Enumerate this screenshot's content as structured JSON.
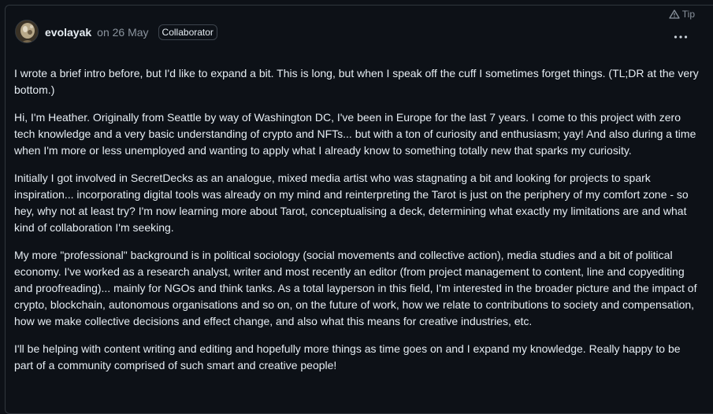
{
  "comment": {
    "author": "evolayak",
    "date": "on 26 May",
    "role_badge": "Collaborator",
    "tip_label": "Tip",
    "icons": {
      "avatar": "user-avatar",
      "tip": "alert-triangle-icon",
      "more": "kebab-horizontal-icon"
    },
    "paragraphs": [
      "I wrote a brief intro before, but I'd like to expand a bit. This is long, but when I speak off the cuff I sometimes forget things. (TL;DR at the very bottom.)",
      "Hi, I'm Heather. Originally from Seattle by way of Washington DC, I've been in Europe for the last 7 years. I come to this project with zero tech knowledge and a very basic understanding of crypto and NFTs... but with a ton of curiosity and enthusiasm; yay! And also during a time when I'm more or less unemployed and wanting to apply what I already know to something totally new that sparks my curiosity.",
      "Initially I got involved in SecretDecks as an analogue, mixed media artist who was stagnating a bit and looking for projects to spark inspiration... incorporating digital tools was already on my mind and reinterpreting the Tarot is just on the periphery of my comfort zone - so hey, why not at least try? I'm now learning more about Tarot, conceptualising a deck, determining what exactly my limitations are and what kind of collaboration I'm seeking.",
      "My more \"professional\" background is in political sociology (social movements and collective action), media studies and a bit of political economy. I've worked as a research analyst, writer and most recently an editor (from project management to content, line and copyediting and proofreading)... mainly for NGOs and think tanks. As a total layperson in this field, I'm interested in the broader picture and the impact of crypto, blockchain, autonomous organisations and so on, on the future of work, how we relate to contributions to society and compensation, how we make collective decisions and effect change, and also what this means for creative industries, etc.",
      "I'll be helping with content writing and editing and hopefully more things as time goes on and I expand my knowledge. Really happy to be part of a community comprised of such smart and creative people!"
    ]
  },
  "colors": {
    "background": "#0d1117",
    "border": "#30363d",
    "text": "#e6edf3",
    "muted": "#8b949e"
  }
}
